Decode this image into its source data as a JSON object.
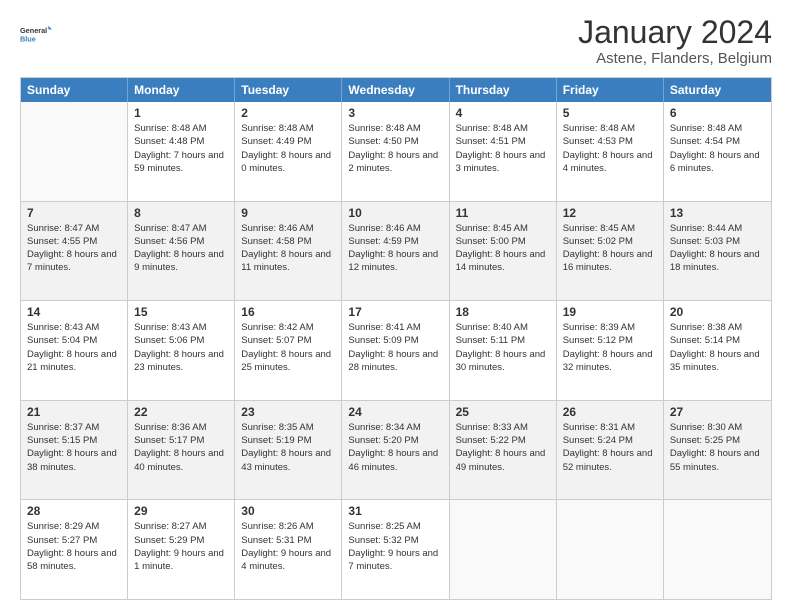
{
  "logo": {
    "text1": "General",
    "text2": "Blue"
  },
  "title": "January 2024",
  "subtitle": "Astene, Flanders, Belgium",
  "days": [
    "Sunday",
    "Monday",
    "Tuesday",
    "Wednesday",
    "Thursday",
    "Friday",
    "Saturday"
  ],
  "weeks": [
    [
      {
        "day": "",
        "sunrise": "",
        "sunset": "",
        "daylight": ""
      },
      {
        "day": "1",
        "sunrise": "Sunrise: 8:48 AM",
        "sunset": "Sunset: 4:48 PM",
        "daylight": "Daylight: 7 hours and 59 minutes."
      },
      {
        "day": "2",
        "sunrise": "Sunrise: 8:48 AM",
        "sunset": "Sunset: 4:49 PM",
        "daylight": "Daylight: 8 hours and 0 minutes."
      },
      {
        "day": "3",
        "sunrise": "Sunrise: 8:48 AM",
        "sunset": "Sunset: 4:50 PM",
        "daylight": "Daylight: 8 hours and 2 minutes."
      },
      {
        "day": "4",
        "sunrise": "Sunrise: 8:48 AM",
        "sunset": "Sunset: 4:51 PM",
        "daylight": "Daylight: 8 hours and 3 minutes."
      },
      {
        "day": "5",
        "sunrise": "Sunrise: 8:48 AM",
        "sunset": "Sunset: 4:53 PM",
        "daylight": "Daylight: 8 hours and 4 minutes."
      },
      {
        "day": "6",
        "sunrise": "Sunrise: 8:48 AM",
        "sunset": "Sunset: 4:54 PM",
        "daylight": "Daylight: 8 hours and 6 minutes."
      }
    ],
    [
      {
        "day": "7",
        "sunrise": "Sunrise: 8:47 AM",
        "sunset": "Sunset: 4:55 PM",
        "daylight": "Daylight: 8 hours and 7 minutes."
      },
      {
        "day": "8",
        "sunrise": "Sunrise: 8:47 AM",
        "sunset": "Sunset: 4:56 PM",
        "daylight": "Daylight: 8 hours and 9 minutes."
      },
      {
        "day": "9",
        "sunrise": "Sunrise: 8:46 AM",
        "sunset": "Sunset: 4:58 PM",
        "daylight": "Daylight: 8 hours and 11 minutes."
      },
      {
        "day": "10",
        "sunrise": "Sunrise: 8:46 AM",
        "sunset": "Sunset: 4:59 PM",
        "daylight": "Daylight: 8 hours and 12 minutes."
      },
      {
        "day": "11",
        "sunrise": "Sunrise: 8:45 AM",
        "sunset": "Sunset: 5:00 PM",
        "daylight": "Daylight: 8 hours and 14 minutes."
      },
      {
        "day": "12",
        "sunrise": "Sunrise: 8:45 AM",
        "sunset": "Sunset: 5:02 PM",
        "daylight": "Daylight: 8 hours and 16 minutes."
      },
      {
        "day": "13",
        "sunrise": "Sunrise: 8:44 AM",
        "sunset": "Sunset: 5:03 PM",
        "daylight": "Daylight: 8 hours and 18 minutes."
      }
    ],
    [
      {
        "day": "14",
        "sunrise": "Sunrise: 8:43 AM",
        "sunset": "Sunset: 5:04 PM",
        "daylight": "Daylight: 8 hours and 21 minutes."
      },
      {
        "day": "15",
        "sunrise": "Sunrise: 8:43 AM",
        "sunset": "Sunset: 5:06 PM",
        "daylight": "Daylight: 8 hours and 23 minutes."
      },
      {
        "day": "16",
        "sunrise": "Sunrise: 8:42 AM",
        "sunset": "Sunset: 5:07 PM",
        "daylight": "Daylight: 8 hours and 25 minutes."
      },
      {
        "day": "17",
        "sunrise": "Sunrise: 8:41 AM",
        "sunset": "Sunset: 5:09 PM",
        "daylight": "Daylight: 8 hours and 28 minutes."
      },
      {
        "day": "18",
        "sunrise": "Sunrise: 8:40 AM",
        "sunset": "Sunset: 5:11 PM",
        "daylight": "Daylight: 8 hours and 30 minutes."
      },
      {
        "day": "19",
        "sunrise": "Sunrise: 8:39 AM",
        "sunset": "Sunset: 5:12 PM",
        "daylight": "Daylight: 8 hours and 32 minutes."
      },
      {
        "day": "20",
        "sunrise": "Sunrise: 8:38 AM",
        "sunset": "Sunset: 5:14 PM",
        "daylight": "Daylight: 8 hours and 35 minutes."
      }
    ],
    [
      {
        "day": "21",
        "sunrise": "Sunrise: 8:37 AM",
        "sunset": "Sunset: 5:15 PM",
        "daylight": "Daylight: 8 hours and 38 minutes."
      },
      {
        "day": "22",
        "sunrise": "Sunrise: 8:36 AM",
        "sunset": "Sunset: 5:17 PM",
        "daylight": "Daylight: 8 hours and 40 minutes."
      },
      {
        "day": "23",
        "sunrise": "Sunrise: 8:35 AM",
        "sunset": "Sunset: 5:19 PM",
        "daylight": "Daylight: 8 hours and 43 minutes."
      },
      {
        "day": "24",
        "sunrise": "Sunrise: 8:34 AM",
        "sunset": "Sunset: 5:20 PM",
        "daylight": "Daylight: 8 hours and 46 minutes."
      },
      {
        "day": "25",
        "sunrise": "Sunrise: 8:33 AM",
        "sunset": "Sunset: 5:22 PM",
        "daylight": "Daylight: 8 hours and 49 minutes."
      },
      {
        "day": "26",
        "sunrise": "Sunrise: 8:31 AM",
        "sunset": "Sunset: 5:24 PM",
        "daylight": "Daylight: 8 hours and 52 minutes."
      },
      {
        "day": "27",
        "sunrise": "Sunrise: 8:30 AM",
        "sunset": "Sunset: 5:25 PM",
        "daylight": "Daylight: 8 hours and 55 minutes."
      }
    ],
    [
      {
        "day": "28",
        "sunrise": "Sunrise: 8:29 AM",
        "sunset": "Sunset: 5:27 PM",
        "daylight": "Daylight: 8 hours and 58 minutes."
      },
      {
        "day": "29",
        "sunrise": "Sunrise: 8:27 AM",
        "sunset": "Sunset: 5:29 PM",
        "daylight": "Daylight: 9 hours and 1 minute."
      },
      {
        "day": "30",
        "sunrise": "Sunrise: 8:26 AM",
        "sunset": "Sunset: 5:31 PM",
        "daylight": "Daylight: 9 hours and 4 minutes."
      },
      {
        "day": "31",
        "sunrise": "Sunrise: 8:25 AM",
        "sunset": "Sunset: 5:32 PM",
        "daylight": "Daylight: 9 hours and 7 minutes."
      },
      {
        "day": "",
        "sunrise": "",
        "sunset": "",
        "daylight": ""
      },
      {
        "day": "",
        "sunrise": "",
        "sunset": "",
        "daylight": ""
      },
      {
        "day": "",
        "sunrise": "",
        "sunset": "",
        "daylight": ""
      }
    ]
  ]
}
